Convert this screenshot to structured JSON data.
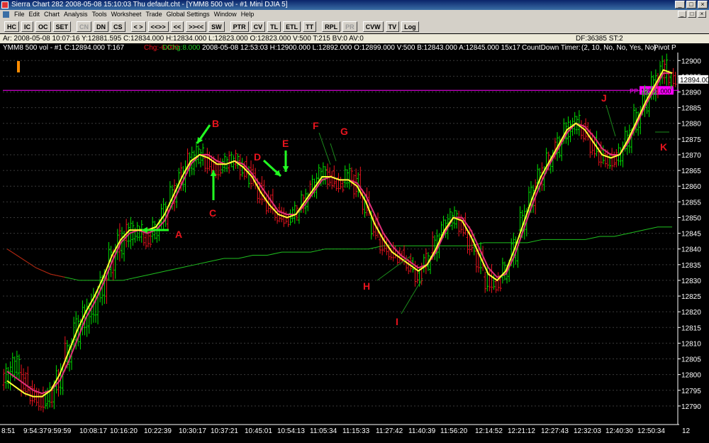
{
  "window": {
    "title": "Sierra Chart 282  2008-05-08  15:10:03  Thu   default.cht - [YMM8  500 vol - #1 Mini DJIA 5]",
    "buttons": [
      "_",
      "□",
      "×"
    ]
  },
  "menu": [
    "File",
    "Edit",
    "Chart",
    "Analysis",
    "Tools",
    "Worksheet",
    "Trade",
    "Global Settings",
    "Window",
    "Help"
  ],
  "mdi_buttons": [
    "_",
    "□",
    "×"
  ],
  "toolbar": [
    {
      "label": "HC",
      "enabled": true
    },
    {
      "label": "IC",
      "enabled": true
    },
    {
      "label": "OC",
      "enabled": true
    },
    {
      "label": "SET",
      "enabled": true
    },
    {
      "label": "CN",
      "enabled": false
    },
    {
      "label": "DN",
      "enabled": true
    },
    {
      "label": "CS",
      "enabled": true
    },
    {
      "label": "< >",
      "enabled": true
    },
    {
      "label": "<<>>",
      "enabled": true
    },
    {
      "label": "<<",
      "enabled": true
    },
    {
      "label": ">><<",
      "enabled": true
    },
    {
      "label": "SW",
      "enabled": true
    },
    {
      "label": "PTR",
      "enabled": true
    },
    {
      "label": "CV",
      "enabled": true
    },
    {
      "label": "TL",
      "enabled": true
    },
    {
      "label": "ETL",
      "enabled": true
    },
    {
      "label": "TT",
      "enabled": true
    },
    {
      "label": "RPL",
      "enabled": true
    },
    {
      "label": "PR",
      "enabled": false
    },
    {
      "label": "CVW",
      "enabled": true
    },
    {
      "label": "TV",
      "enabled": true
    },
    {
      "label": "Log",
      "enabled": true
    }
  ],
  "info": {
    "left": "Ar: 2008-05-08  10:07:16  Y:12881.595  C:12834.000  H:12834.000  L:12823.000  O:12823.000  V:500  T:215  BV:0  AV:0",
    "right": "DF:36385  ST:2"
  },
  "study": {
    "a": "YMM8  500 vol - #1  C:12894.000  T:167",
    "chg": "Chg:-6.000",
    "dchg": "DChg:8.000",
    "b": "2008-05-08  12:53:03  H:12900.000  L:12892.000  O:12899.000  V:500  B:12843.000  A:12845.000  15x17",
    "countdown": "CountDown Timer:",
    "params": "(2, 10, No, No, Yes, No)",
    "pivot": "Pivot P"
  },
  "colors": {
    "up_bar": "#00e000",
    "down_bar": "#e8141e",
    "ma_yellow": "#ffff33",
    "ma_pink": "#e0307a",
    "pp_line": "#ff00ff",
    "grid": "#3a3a3a",
    "price_axis_bg": "#ffffff",
    "orange_marker": "#ff8c00",
    "annotation": "#e8141e",
    "arrow": "#22ff22"
  },
  "chart_data": {
    "type": "candlestick",
    "y_range": [
      12785,
      12903
    ],
    "y_ticks": [
      12790,
      12795,
      12800,
      12805,
      12810,
      12815,
      12820,
      12825,
      12830,
      12835,
      12840,
      12845,
      12850,
      12855,
      12860,
      12865,
      12870,
      12875,
      12880,
      12885,
      12890,
      12895,
      12900
    ],
    "x_labels": [
      "8:51",
      "9:54:37",
      "9:59:59",
      "10:08:17",
      "10:16:20",
      "10:22:39",
      "10:30:17",
      "10:37:21",
      "10:45:01",
      "10:54:13",
      "11:05:34",
      "11:15:33",
      "11:27:42",
      "11:40:39",
      "11:56:20",
      "12:14:52",
      "12:21:12",
      "12:27:43",
      "12:32:03",
      "12:40:30",
      "12:50:34",
      "12"
    ],
    "last_price": "12894.000",
    "pivot_label": "PP",
    "pivot_value": "12891.000",
    "pivot_level": 12890.5,
    "annotations": [
      "A",
      "B",
      "C",
      "D",
      "E",
      "F",
      "G",
      "H",
      "I",
      "J",
      "K"
    ],
    "price_path": [
      [
        12802,
        12797
      ],
      [
        12806,
        12800
      ],
      [
        12801,
        12795
      ],
      [
        12796,
        12792
      ],
      [
        12794,
        12790
      ],
      [
        12796,
        12791
      ],
      [
        12802,
        12795
      ],
      [
        12810,
        12803
      ],
      [
        12818,
        12810
      ],
      [
        12822,
        12814
      ],
      [
        12826,
        12818
      ],
      [
        12832,
        12824
      ],
      [
        12840,
        12832
      ],
      [
        12846,
        12838
      ],
      [
        12848,
        12842
      ],
      [
        12847,
        12844
      ],
      [
        12845,
        12842
      ],
      [
        12848,
        12844
      ],
      [
        12854,
        12848
      ],
      [
        12860,
        12854
      ],
      [
        12866,
        12860
      ],
      [
        12871,
        12865
      ],
      [
        12872,
        12868
      ],
      [
        12870,
        12866
      ],
      [
        12868,
        12864
      ],
      [
        12869,
        12866
      ],
      [
        12870,
        12867
      ],
      [
        12868,
        12864
      ],
      [
        12866,
        12861
      ],
      [
        12861,
        12856
      ],
      [
        12857,
        12853
      ],
      [
        12853,
        12850
      ],
      [
        12851,
        12849
      ],
      [
        12853,
        12850
      ],
      [
        12857,
        12853
      ],
      [
        12862,
        12858
      ],
      [
        12866,
        12862
      ],
      [
        12865,
        12861
      ],
      [
        12862,
        12860
      ],
      [
        12865,
        12861
      ],
      [
        12864,
        12858
      ],
      [
        12858,
        12852
      ],
      [
        12850,
        12845
      ],
      [
        12844,
        12840
      ],
      [
        12840,
        12838
      ],
      [
        12839,
        12837
      ],
      [
        12837,
        12834
      ],
      [
        12834,
        12830
      ],
      [
        12838,
        12834
      ],
      [
        12844,
        12838
      ],
      [
        12849,
        12845
      ],
      [
        12852,
        12848
      ],
      [
        12850,
        12846
      ],
      [
        12845,
        12840
      ],
      [
        12840,
        12834
      ],
      [
        12833,
        12828
      ],
      [
        12831,
        12828
      ],
      [
        12835,
        12831
      ],
      [
        12843,
        12836
      ],
      [
        12852,
        12845
      ],
      [
        12860,
        12853
      ],
      [
        12866,
        12860
      ],
      [
        12870,
        12866
      ],
      [
        12875,
        12870
      ],
      [
        12880,
        12875
      ],
      [
        12882,
        12878
      ],
      [
        12880,
        12876
      ],
      [
        12876,
        12871
      ],
      [
        12872,
        12868
      ],
      [
        12870,
        12867
      ],
      [
        12872,
        12868
      ],
      [
        12878,
        12872
      ],
      [
        12884,
        12878
      ],
      [
        12890,
        12884
      ],
      [
        12895,
        12889
      ],
      [
        12900,
        12894
      ],
      [
        12896,
        12893
      ]
    ],
    "ma_yellow": [
      12798,
      12796,
      12794,
      12793,
      12793,
      12795,
      12800,
      12807,
      12814,
      12820,
      12825,
      12831,
      12838,
      12843,
      12846,
      12846,
      12846,
      12847,
      12851,
      12857,
      12863,
      12868,
      12870,
      12869,
      12867,
      12867,
      12868,
      12866,
      12863,
      12858,
      12854,
      12851,
      12850,
      12851,
      12855,
      12859,
      12863,
      12863,
      12862,
      12862,
      12860,
      12855,
      12848,
      12843,
      12839,
      12837,
      12835,
      12833,
      12835,
      12840,
      12846,
      12850,
      12849,
      12844,
      12838,
      12832,
      12830,
      12833,
      12840,
      12848,
      12856,
      12863,
      12868,
      12873,
      12878,
      12880,
      12878,
      12874,
      12870,
      12869,
      12870,
      12875,
      12881,
      12887,
      12892,
      12897,
      12896
    ],
    "ma_pink": [
      12801,
      12799,
      12797,
      12795,
      12794,
      12795,
      12798,
      12804,
      12811,
      12818,
      12823,
      12829,
      12836,
      12842,
      12845,
      12846,
      12845,
      12846,
      12849,
      12855,
      12861,
      12867,
      12870,
      12870,
      12868,
      12867,
      12868,
      12867,
      12864,
      12860,
      12856,
      12852,
      12851,
      12851,
      12854,
      12858,
      12862,
      12863,
      12862,
      12862,
      12861,
      12857,
      12851,
      12845,
      12841,
      12838,
      12836,
      12834,
      12835,
      12839,
      12845,
      12850,
      12850,
      12846,
      12840,
      12834,
      12831,
      12832,
      12838,
      12846,
      12854,
      12861,
      12867,
      12872,
      12877,
      12880,
      12879,
      12876,
      12872,
      12870,
      12870,
      12874,
      12880,
      12886,
      12891,
      12896,
      12896
    ],
    "ma_green_long": [
      12840,
      12837,
      12834,
      12832,
      12831,
      12830,
      12830,
      12830,
      12830,
      12831,
      12832,
      12833,
      12834,
      12835,
      12836,
      12837,
      12837,
      12838,
      12838,
      12839,
      12839,
      12839,
      12840,
      12840,
      12840,
      12840,
      12841,
      12841,
      12841,
      12841,
      12841,
      12841,
      12841,
      12842,
      12842,
      12842,
      12842,
      12843,
      12843,
      12843,
      12843,
      12844,
      12844,
      12845,
      12846,
      12847,
      12847
    ]
  }
}
